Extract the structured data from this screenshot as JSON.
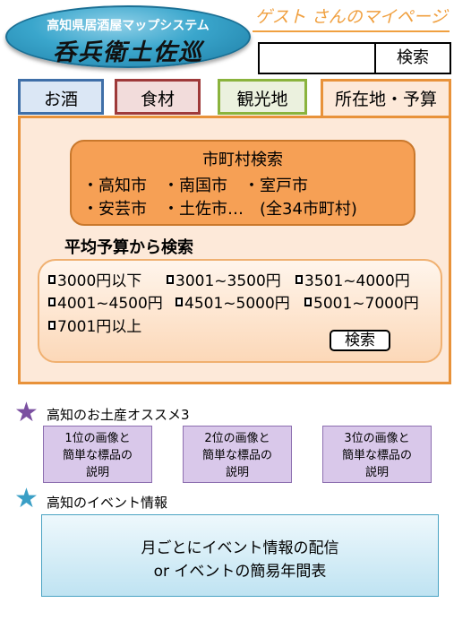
{
  "header": {
    "logo_subtitle": "高知県居酒屋マップシステム",
    "logo_title": "呑兵衛土佐巡",
    "mypage_link": "ゲスト さんのマイページ",
    "search_placeholder": "",
    "search_button": "検索"
  },
  "tabs": [
    {
      "label": "お酒"
    },
    {
      "label": "食材"
    },
    {
      "label": "観光地"
    },
    {
      "label": "所在地・予算"
    }
  ],
  "city_search": {
    "title": "市町村検索",
    "row1": "・高知市　・南国市　・室戸市",
    "row2": "・安芸市　・土佐市…　(全34市町村)"
  },
  "budget_search": {
    "title": "平均予算から検索",
    "options": [
      "3000円以下",
      "3001~3500円",
      "3501~4000円",
      "4001~4500円",
      "4501~5000円",
      "5001~7000円",
      "7001円以上"
    ],
    "search_button": "検索"
  },
  "souvenirs": {
    "title": "高知のお土産オススメ3",
    "cards": [
      {
        "line1": "1位の画像と",
        "line2": "簡単な標品の",
        "line3": "説明"
      },
      {
        "line1": "2位の画像と",
        "line2": "簡単な標品の",
        "line3": "説明"
      },
      {
        "line1": "3位の画像と",
        "line2": "簡単な標品の",
        "line3": "説明"
      }
    ]
  },
  "events": {
    "title": "高知のイベント情報",
    "line1": "月ごとにイベント情報の配信",
    "line2": "or イベントの簡易年間表"
  },
  "icons": {
    "star1": "star-icon",
    "star2": "star-icon"
  },
  "colors": {
    "accent_orange": "#e8923a",
    "mypage_text": "#f0a040",
    "star_purple": "#7a4fa0",
    "star_blue": "#3a9fc6"
  }
}
